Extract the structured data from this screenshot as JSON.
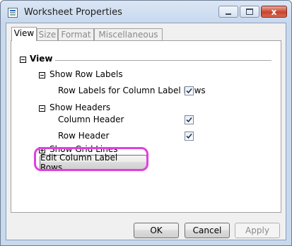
{
  "window": {
    "title": "Worksheet Properties",
    "close_glyph": "x",
    "accent": "#e040e0"
  },
  "tabs": [
    {
      "label": "View",
      "active": true
    },
    {
      "label": "Size",
      "active": false
    },
    {
      "label": "Format",
      "active": false
    },
    {
      "label": "Miscellaneous",
      "active": false
    }
  ],
  "view": {
    "section_label": "View",
    "show_row_labels": "Show Row Labels",
    "row_labels_for_column_label_rows": "Row Labels for Column Label Rows",
    "show_headers": "Show Headers",
    "column_header": "Column Header",
    "row_header": "Row Header",
    "show_grid_lines": "Show Grid Lines",
    "edit_button": "Edit Column Label Rows..."
  },
  "checkboxes": {
    "row_labels_for_column_label_rows": true,
    "column_header": true,
    "row_header": true
  },
  "footer": {
    "ok": "OK",
    "cancel": "Cancel",
    "apply": "Apply"
  }
}
